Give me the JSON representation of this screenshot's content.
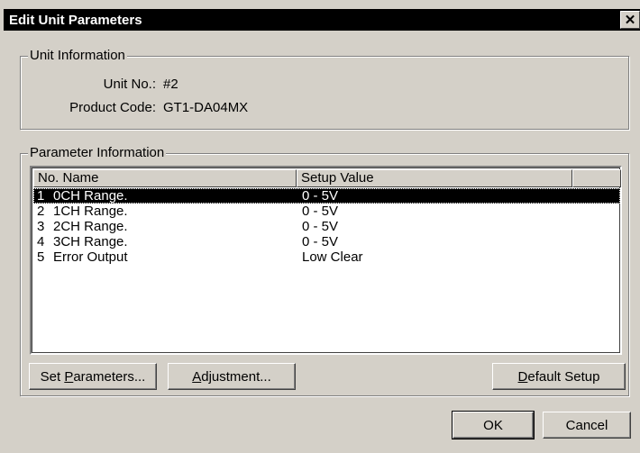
{
  "window": {
    "title": "Edit Unit Parameters",
    "close_label": "✕"
  },
  "unit_info": {
    "group_label": "Unit Information",
    "unit_no_label": "Unit No.:",
    "unit_no_value": "#2",
    "product_code_label": "Product Code:",
    "product_code_value": "GT1-DA04MX"
  },
  "param_info": {
    "group_label": "Parameter Information",
    "columns": [
      "No. Name",
      "Setup Value",
      ""
    ],
    "rows": [
      {
        "no": "1",
        "name": "0CH Range.",
        "value": "0 - 5V",
        "selected": true
      },
      {
        "no": "2",
        "name": "1CH Range.",
        "value": "0 - 5V",
        "selected": false
      },
      {
        "no": "3",
        "name": "2CH Range.",
        "value": "0 - 5V",
        "selected": false
      },
      {
        "no": "4",
        "name": "3CH Range.",
        "value": "0 - 5V",
        "selected": false
      },
      {
        "no": "5",
        "name": "Error Output",
        "value": "Low Clear",
        "selected": false
      }
    ]
  },
  "buttons": {
    "set_parameters": {
      "pre": "Set ",
      "accel": "P",
      "post": "arameters..."
    },
    "adjustment": {
      "pre": "",
      "accel": "A",
      "post": "djustment..."
    },
    "default_setup": {
      "pre": "",
      "accel": "D",
      "post": "efault Setup"
    },
    "ok": "OK",
    "cancel": "Cancel"
  }
}
